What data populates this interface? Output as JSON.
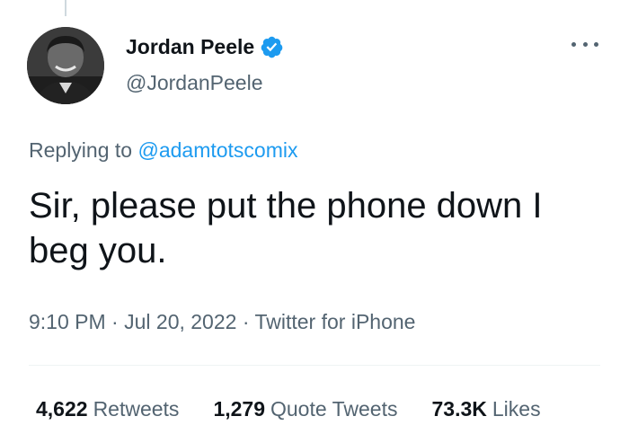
{
  "author": {
    "display_name": "Jordan Peele",
    "handle": "@JordanPeele",
    "avatar_icon": "avatar-photo",
    "verified": true
  },
  "reply": {
    "prefix": "Replying to",
    "handle": "@adamtotscomix"
  },
  "tweet": {
    "text": "Sir, please put the phone down I beg you."
  },
  "meta": {
    "time": "9:10 PM",
    "separator": "·",
    "date": "Jul 20, 2022",
    "source": "Twitter for iPhone"
  },
  "stats": {
    "retweets_count": "4,622",
    "retweets_label": "Retweets",
    "quotes_count": "1,279",
    "quotes_label": "Quote Tweets",
    "likes_count": "73.3K",
    "likes_label": "Likes"
  },
  "colors": {
    "accent": "#1d9bf0",
    "text_primary": "#0f1419",
    "text_secondary": "#536471"
  }
}
